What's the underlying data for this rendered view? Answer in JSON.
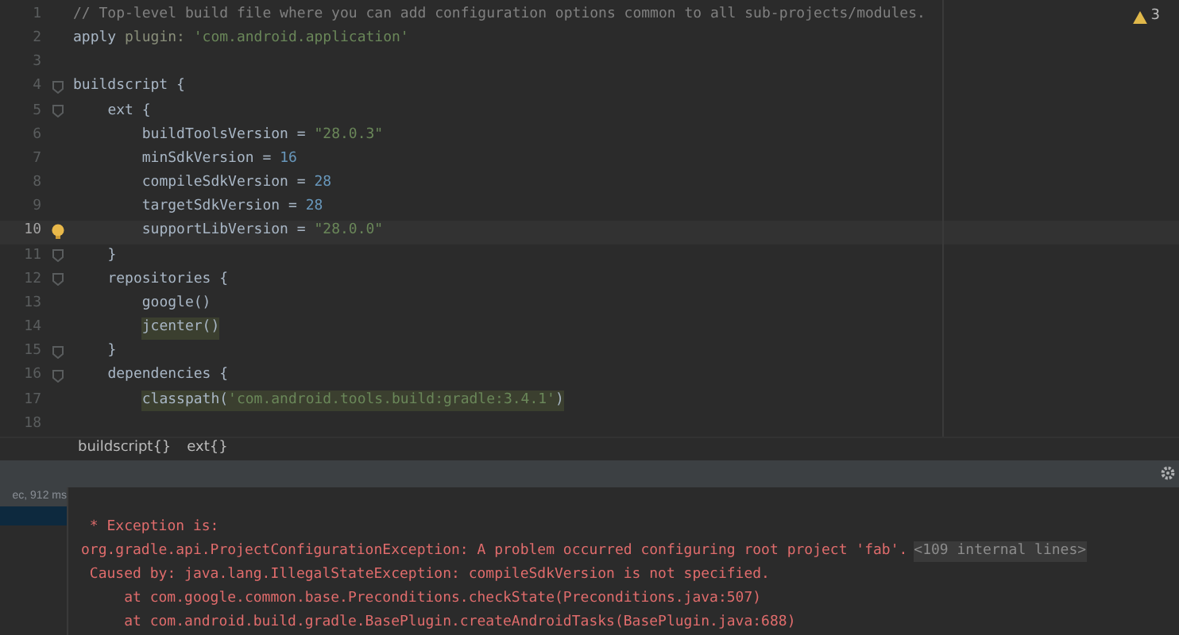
{
  "editor": {
    "warnings": {
      "count": "3"
    },
    "lines": [
      {
        "number": "1",
        "fold": false,
        "current": false,
        "bulb": false,
        "tokens": [
          {
            "text": "// Top-level build file where you can add configuration options common to all sub-projects/modules.",
            "kind": "comment"
          }
        ]
      },
      {
        "number": "2",
        "fold": false,
        "current": false,
        "bulb": false,
        "tokens": [
          {
            "text": "apply ",
            "kind": "plain"
          },
          {
            "text": "plugin: ",
            "kind": "keyword"
          },
          {
            "text": "'com.android.application'",
            "kind": "string"
          }
        ]
      },
      {
        "number": "3",
        "fold": false,
        "current": false,
        "bulb": false
      },
      {
        "number": "4",
        "fold": true,
        "current": false,
        "bulb": false,
        "tokens": [
          {
            "text": "buildscript {",
            "kind": "plain"
          }
        ]
      },
      {
        "number": "5",
        "fold": true,
        "current": false,
        "bulb": false,
        "tokens": [
          {
            "text": "    ext {",
            "kind": "plain"
          }
        ]
      },
      {
        "number": "6",
        "fold": false,
        "current": false,
        "bulb": false,
        "tokens": [
          {
            "text": "        buildToolsVersion = ",
            "kind": "plain"
          },
          {
            "text": "\"28.0.3\"",
            "kind": "string"
          }
        ]
      },
      {
        "number": "7",
        "fold": false,
        "current": false,
        "bulb": false,
        "tokens": [
          {
            "text": "        minSdkVersion = ",
            "kind": "plain"
          },
          {
            "text": "16",
            "kind": "number"
          }
        ]
      },
      {
        "number": "8",
        "fold": false,
        "current": false,
        "bulb": false,
        "tokens": [
          {
            "text": "        compileSdkVersion = ",
            "kind": "plain"
          },
          {
            "text": "28",
            "kind": "number"
          }
        ]
      },
      {
        "number": "9",
        "fold": false,
        "current": false,
        "bulb": false,
        "tokens": [
          {
            "text": "        targetSdkVersion = ",
            "kind": "plain"
          },
          {
            "text": "28",
            "kind": "number"
          }
        ]
      },
      {
        "number": "10",
        "fold": false,
        "current": true,
        "bulb": true,
        "tokens": [
          {
            "text": "        supportLibVersion = ",
            "kind": "plain"
          },
          {
            "text": "\"28.0.0\"",
            "kind": "string"
          }
        ]
      },
      {
        "number": "11",
        "fold": true,
        "current": false,
        "bulb": false,
        "tokens": [
          {
            "text": "    }",
            "kind": "plain"
          }
        ]
      },
      {
        "number": "12",
        "fold": true,
        "current": false,
        "bulb": false,
        "tokens": [
          {
            "text": "    repositories {",
            "kind": "plain"
          }
        ]
      },
      {
        "number": "13",
        "fold": false,
        "current": false,
        "bulb": false,
        "tokens": [
          {
            "text": "        google()",
            "kind": "plain"
          }
        ]
      },
      {
        "number": "14",
        "fold": false,
        "current": false,
        "bulb": false,
        "tokens": [
          {
            "text": "        jcenter()",
            "kind": "marked"
          }
        ]
      },
      {
        "number": "15",
        "fold": true,
        "current": false,
        "bulb": false,
        "tokens": [
          {
            "text": "    }",
            "kind": "plain"
          }
        ]
      },
      {
        "number": "16",
        "fold": true,
        "current": false,
        "bulb": false,
        "tokens": [
          {
            "text": "    dependencies {",
            "kind": "plain"
          }
        ]
      },
      {
        "number": "17",
        "fold": false,
        "current": false,
        "bulb": false,
        "tokens": [
          {
            "text": "        classpath(",
            "kind": "marked"
          },
          {
            "text": "'com.android.tools.build:gradle:3.4.1'",
            "kind": "marked-string"
          },
          {
            "text": ")",
            "kind": "marked"
          }
        ]
      },
      {
        "number": "18",
        "fold": false,
        "current": false,
        "bulb": false
      }
    ]
  },
  "breadcrumbs": [
    "buildscript{}",
    "ext{}"
  ],
  "console": {
    "sidebar": {
      "item": "ec, 912 ms"
    },
    "lines": [
      {
        "tokens": [
          {
            "text": " * Exception is:",
            "kind": "error"
          }
        ]
      },
      {
        "tokens": [
          {
            "text": "org.gradle.api.ProjectConfigurationException: A problem occurred configuring root project 'fab'.",
            "kind": "error"
          },
          {
            "text": "<109 internal lines>",
            "kind": "folded"
          }
        ]
      },
      {
        "tokens": [
          {
            "text": " Caused by: java.lang.IllegalStateException: compileSdkVersion is not specified.",
            "kind": "error"
          }
        ]
      },
      {
        "tokens": [
          {
            "text": "     at com.google.common.base.Preconditions.checkState(Preconditions.java:507)",
            "kind": "error"
          }
        ]
      },
      {
        "tokens": [
          {
            "text": "     at com.android.build.gradle.BasePlugin.createAndroidTasks(BasePlugin.java:688)",
            "kind": "error"
          }
        ]
      }
    ]
  }
}
